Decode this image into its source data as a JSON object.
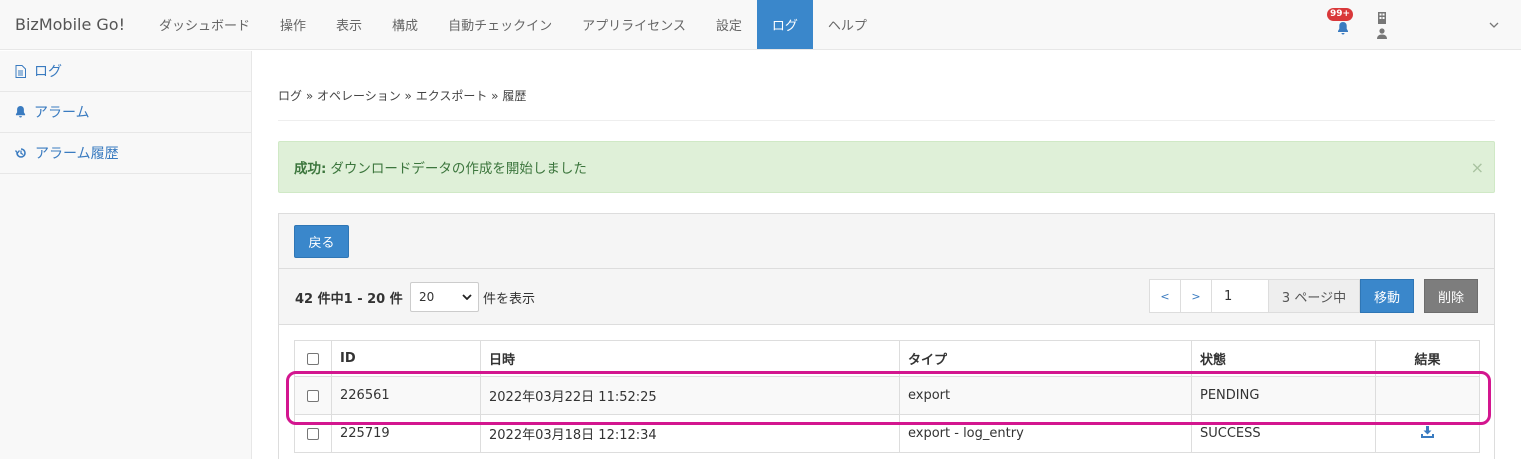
{
  "nav": {
    "brand": "BizMobile Go!",
    "items": [
      {
        "label": "ダッシュボード",
        "active": false
      },
      {
        "label": "操作",
        "active": false
      },
      {
        "label": "表示",
        "active": false
      },
      {
        "label": "構成",
        "active": false
      },
      {
        "label": "自動チェックイン",
        "active": false
      },
      {
        "label": "アプリライセンス",
        "active": false
      },
      {
        "label": "設定",
        "active": false
      },
      {
        "label": "ログ",
        "active": true
      },
      {
        "label": "ヘルプ",
        "active": false
      }
    ],
    "notification_count": "99+"
  },
  "sidebar": {
    "items": [
      {
        "label": "ログ",
        "icon": "file-text-icon"
      },
      {
        "label": "アラーム",
        "icon": "bell-icon"
      },
      {
        "label": "アラーム履歴",
        "icon": "history-icon"
      }
    ]
  },
  "breadcrumb": "ログ » オペレーション » エクスポート » 履歴",
  "alert": {
    "strong": "成功:",
    "message": "ダウンロードデータの作成を開始しました",
    "close": "×"
  },
  "panel": {
    "back_label": "戻る",
    "count_text": "42 件中1 - 20 件",
    "per_page_value": "20",
    "per_page_label": "件を表示",
    "pager": {
      "prev": "<",
      "next": ">",
      "page_value": "1",
      "page_of": "3 ページ中",
      "go_label": "移動",
      "delete_label": "削除"
    }
  },
  "table": {
    "headers": {
      "id": "ID",
      "datetime": "日時",
      "type": "タイプ",
      "status": "状態",
      "result": "結果"
    },
    "rows": [
      {
        "id": "226561",
        "datetime": "2022年03月22日 11:52:25",
        "type": "export",
        "status": "PENDING",
        "result_icon": ""
      },
      {
        "id": "225719",
        "datetime": "2022年03月18日 12:12:34",
        "type": "export - log_entry",
        "status": "SUCCESS",
        "result_icon": "download-icon"
      }
    ]
  },
  "colors": {
    "primary": "#3a87cb",
    "highlight": "#d3168f",
    "success_bg": "#dff0d8",
    "badge": "#d9383a"
  }
}
